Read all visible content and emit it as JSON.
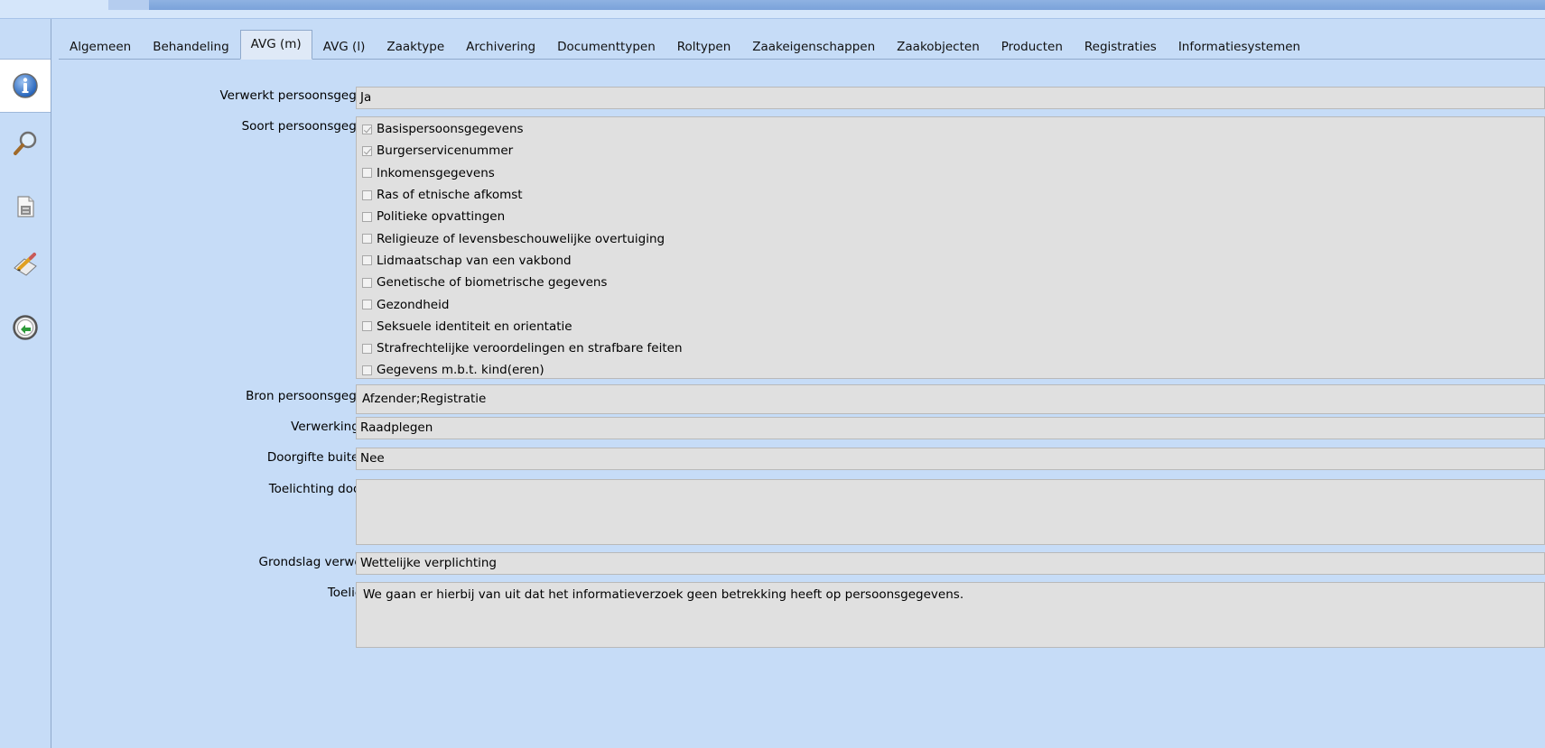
{
  "tabs": [
    {
      "label": "Algemeen",
      "selected": false
    },
    {
      "label": "Behandeling",
      "selected": false
    },
    {
      "label": "AVG (m)",
      "selected": true
    },
    {
      "label": "AVG (l)",
      "selected": false
    },
    {
      "label": "Zaaktype",
      "selected": false
    },
    {
      "label": "Archivering",
      "selected": false
    },
    {
      "label": "Documenttypen",
      "selected": false
    },
    {
      "label": "Roltypen",
      "selected": false
    },
    {
      "label": "Zaakeigenschappen",
      "selected": false
    },
    {
      "label": "Zaakobjecten",
      "selected": false
    },
    {
      "label": "Producten",
      "selected": false
    },
    {
      "label": "Registraties",
      "selected": false
    },
    {
      "label": "Informatiesystemen",
      "selected": false
    }
  ],
  "sidebar": {
    "icons": [
      "info-icon",
      "search-icon",
      "document-icon",
      "edit-icon",
      "history-icon"
    ],
    "active": "info-icon"
  },
  "form": {
    "verwerkt": {
      "label": "Verwerkt persoonsgegevens",
      "value": "Ja"
    },
    "soort": {
      "label": "Soort persoonsgegevens",
      "options": [
        {
          "label": "Basispersoonsgegevens",
          "checked": true
        },
        {
          "label": "Burgerservicenummer",
          "checked": true
        },
        {
          "label": "Inkomensgegevens",
          "checked": false
        },
        {
          "label": "Ras of etnische afkomst",
          "checked": false
        },
        {
          "label": "Politieke opvattingen",
          "checked": false
        },
        {
          "label": "Religieuze of levensbeschouwelijke overtuiging",
          "checked": false
        },
        {
          "label": "Lidmaatschap van een vakbond",
          "checked": false
        },
        {
          "label": "Genetische of biometrische gegevens",
          "checked": false
        },
        {
          "label": "Gezondheid",
          "checked": false
        },
        {
          "label": "Seksuele identiteit en orientatie",
          "checked": false
        },
        {
          "label": "Strafrechtelijke veroordelingen en strafbare feiten",
          "checked": false
        },
        {
          "label": "Gegevens m.b.t. kind(eren)",
          "checked": false
        }
      ]
    },
    "bron": {
      "label": "Bron persoonsgegevens",
      "value": "Afzender;Registratie"
    },
    "verwerkingstype": {
      "label": "Verwerkingstype",
      "value": "Raadplegen"
    },
    "doorgifte": {
      "label": "Doorgifte buitenland",
      "value": "Nee"
    },
    "toelichting_doorgifte": {
      "label": "Toelichting doorgifte",
      "value": ""
    },
    "grondslag": {
      "label": "Grondslag verwerking",
      "value": "Wettelijke verplichting"
    },
    "toelichting": {
      "label": "Toelichting",
      "value": "We gaan er hierbij van uit dat het informatieverzoek geen betrekking heeft op persoonsgegevens."
    }
  },
  "colors": {
    "background": "#c6dcf7",
    "field_background": "#e0e0e0",
    "accent": "#7aa2da"
  }
}
